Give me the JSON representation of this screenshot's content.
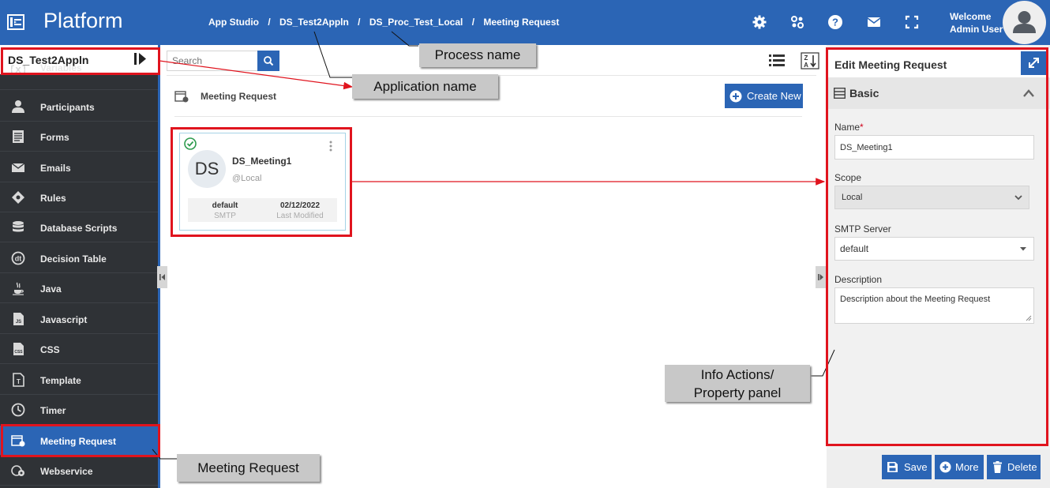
{
  "app": {
    "brand": "Platform",
    "breadcrumb": [
      "App Studio",
      "DS_Test2Appln",
      "DS_Proc_Test_Local",
      "Meeting Request"
    ],
    "breadcrumb_sep": "/",
    "welcome_line1": "Welcome",
    "welcome_line2": "Admin User",
    "header_icons": [
      "settings-icon",
      "apps-icon",
      "help-icon",
      "mail-icon",
      "fullscreen-icon",
      "user-avatar-icon"
    ]
  },
  "sidebar": {
    "title": "DS_Test2Appln",
    "items": [
      {
        "label": "Variables",
        "icon": "variables-icon"
      },
      {
        "label": "Participants",
        "icon": "participants-icon"
      },
      {
        "label": "Forms",
        "icon": "forms-icon"
      },
      {
        "label": "Emails",
        "icon": "email-icon"
      },
      {
        "label": "Rules",
        "icon": "rules-icon"
      },
      {
        "label": "Database Scripts",
        "icon": "database-icon"
      },
      {
        "label": "Decision Table",
        "icon": "decision-table-icon"
      },
      {
        "label": "Java",
        "icon": "java-icon"
      },
      {
        "label": "Javascript",
        "icon": "javascript-icon"
      },
      {
        "label": "CSS",
        "icon": "css-icon"
      },
      {
        "label": "Template",
        "icon": "template-icon"
      },
      {
        "label": "Timer",
        "icon": "timer-icon"
      },
      {
        "label": "Meeting Request",
        "icon": "meeting-request-icon",
        "active": true
      },
      {
        "label": "Webservice",
        "icon": "webservice-icon"
      }
    ]
  },
  "main": {
    "search_placeholder": "Search",
    "section_title": "Meeting Request",
    "create_new_label": "Create New",
    "card": {
      "initials": "DS",
      "name": "DS_Meeting1",
      "scope": "@Local",
      "server_value": "default",
      "server_label": "SMTP",
      "date_value": "02/12/2022",
      "date_label": "Last Modified"
    }
  },
  "panel": {
    "title": "Edit Meeting Request",
    "section": "Basic",
    "name_label": "Name",
    "required_mark": "*",
    "name_value": "DS_Meeting1",
    "scope_label": "Scope",
    "scope_value": "Local",
    "smtp_label": "SMTP Server",
    "smtp_value": "default",
    "description_label": "Description",
    "description_value": "Description about the Meeting Request",
    "save_label": "Save",
    "more_label": "More",
    "delete_label": "Delete"
  },
  "annotations": {
    "process_name": "Process name",
    "application_name": "Application name",
    "info_actions_line1": "Info Actions/",
    "info_actions_line2": "Property panel",
    "meeting_request": "Meeting Request",
    "highlight_color": "#e0141e"
  },
  "colors": {
    "brand_blue": "#2b65b5",
    "sidebar_dark": "#2f3236",
    "callout_grey": "#c8c8c8"
  }
}
